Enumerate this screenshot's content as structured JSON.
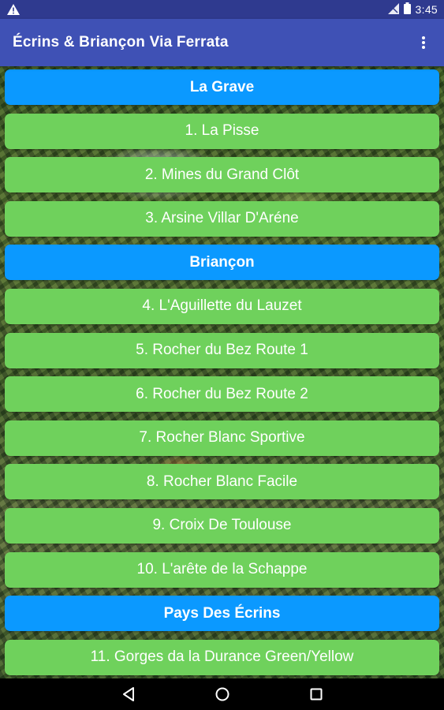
{
  "status_bar": {
    "time": "3:45",
    "icons": [
      "warning-icon",
      "signal-off-icon",
      "battery-icon"
    ]
  },
  "app_bar": {
    "title": "Écrins & Briançon Via Ferrata",
    "menu_icon": "overflow-menu-icon"
  },
  "colors": {
    "status_bar": "#2f3a8f",
    "app_bar": "#3f51b5",
    "section_header": "#0b99ff",
    "route_item": "#6fd15c"
  },
  "sections": [
    {
      "title": "La Grave",
      "routes": [
        "1. La Pisse",
        "2. Mines du Grand Clôt",
        "3. Arsine Villar D'Aréne"
      ]
    },
    {
      "title": "Briançon",
      "routes": [
        "4. L'Aguillette du Lauzet",
        "5. Rocher du Bez Route 1",
        "6. Rocher du Bez Route 2",
        "7. Rocher Blanc Sportive",
        "8. Rocher Blanc Facile",
        "9. Croix De Toulouse",
        "10. L'arête de la Schappe"
      ]
    },
    {
      "title": "Pays Des Écrins",
      "routes": [
        "11. Gorges da la Durance Green/Yellow"
      ]
    }
  ],
  "nav_bar": {
    "icons": [
      "back-icon",
      "home-icon",
      "recents-icon"
    ]
  }
}
